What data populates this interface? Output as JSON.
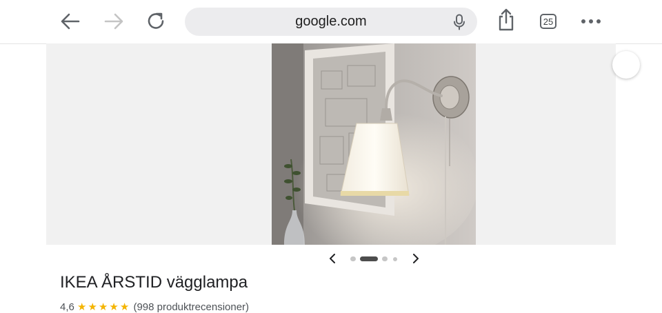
{
  "browser": {
    "url": "google.com",
    "tab_count": "25",
    "icons": {
      "back": "back-arrow-icon",
      "forward": "forward-arrow-icon",
      "reload": "reload-icon",
      "mic": "microphone-icon",
      "share": "share-icon",
      "tabs": "tabs-icon",
      "more": "more-icon"
    }
  },
  "gallery": {
    "image_alt": "IKEA ÅRSTID vägglampa",
    "dot_count": 4,
    "active_dot": 1
  },
  "product": {
    "title": "IKEA ÅRSTID vägglampa",
    "rating_value": "4,6",
    "stars": "★★★★★",
    "reviews_text": "(998 produktrecensioner)"
  },
  "colors": {
    "accent_star": "#f4b400",
    "url_bar_bg": "#ececee",
    "gallery_bg": "#f1f1f1"
  }
}
